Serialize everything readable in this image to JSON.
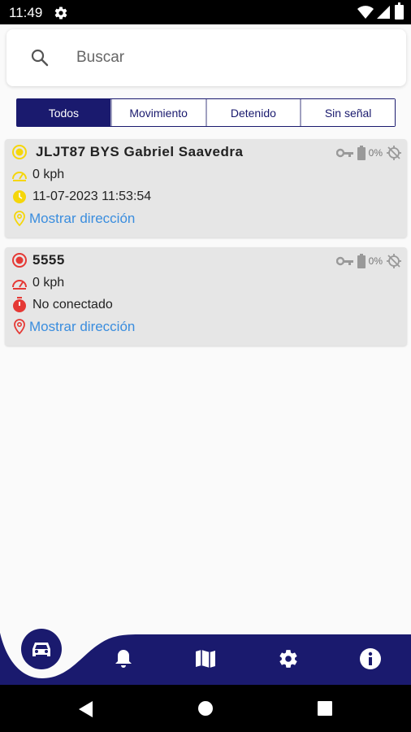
{
  "status_bar": {
    "time": "11:49"
  },
  "search": {
    "placeholder": "Buscar"
  },
  "filters": [
    {
      "label": "Todos",
      "active": true
    },
    {
      "label": "Movimiento",
      "active": false
    },
    {
      "label": "Detenido",
      "active": false
    },
    {
      "label": "Sin señal",
      "active": false
    }
  ],
  "vehicles": [
    {
      "name": "JLJT87 BYS Gabriel Saavedra",
      "speed": "0 kph",
      "status_text": "11-07-2023 11:53:54",
      "address_link": "Mostrar dirección",
      "battery_pct": "0%",
      "status_color": "#f5d60a"
    },
    {
      "name": "5555",
      "speed": "0 kph",
      "status_text": "No conectado",
      "address_link": "Mostrar dirección",
      "battery_pct": "0%",
      "status_color": "#e53935"
    }
  ],
  "bottom_nav": {
    "items": [
      "car-icon",
      "bell-icon",
      "map-icon",
      "gear-icon",
      "info-icon"
    ],
    "color": "#1a1a6e"
  }
}
